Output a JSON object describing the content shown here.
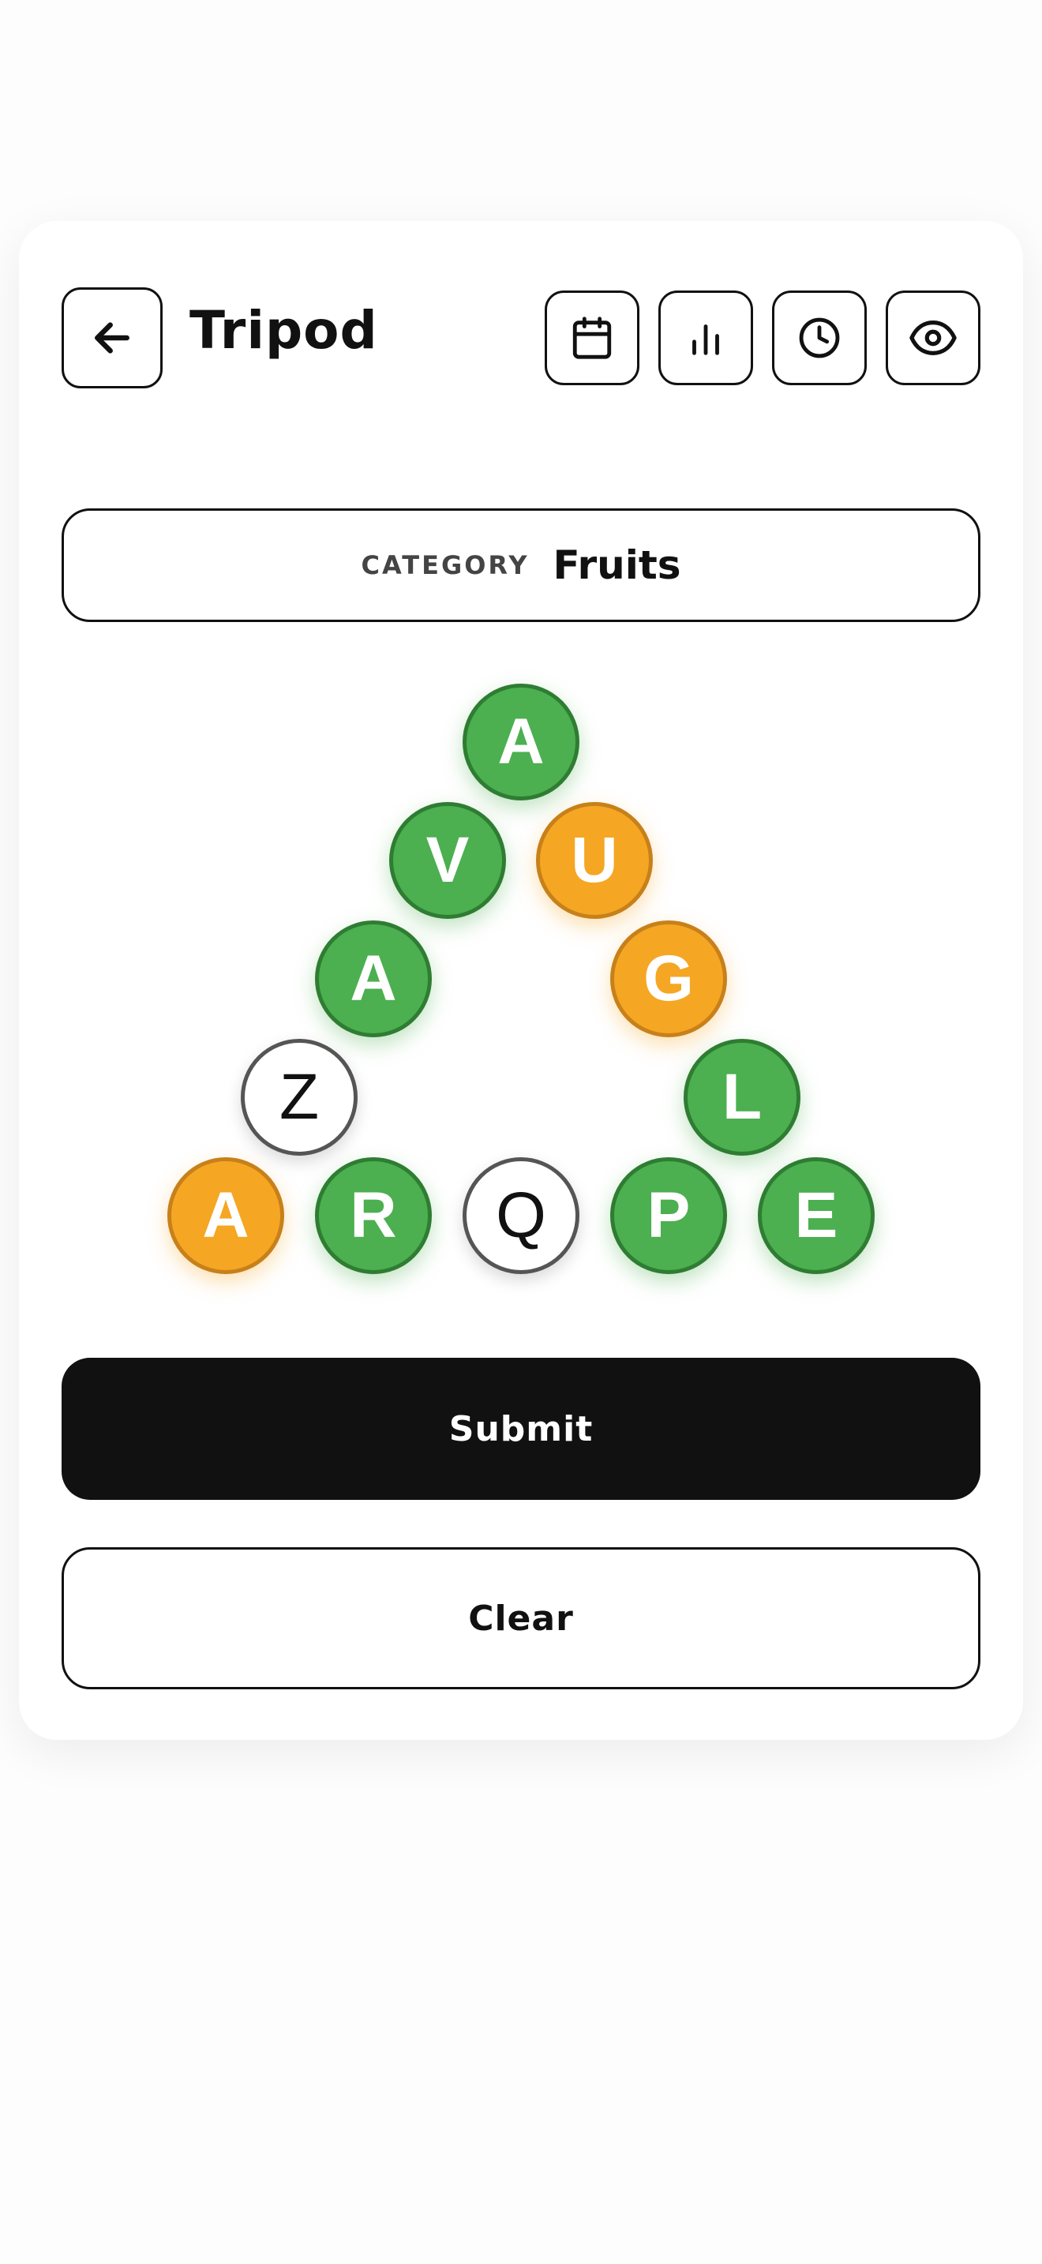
{
  "header": {
    "title": "Tripod",
    "icons": [
      "back-arrow-icon",
      "calendar-icon",
      "stats-icon",
      "clock-icon",
      "eye-icon"
    ]
  },
  "category": {
    "label": "CATEGORY",
    "value": "Fruits"
  },
  "board": {
    "tiles": [
      {
        "letter": "A",
        "state": "green"
      },
      {
        "letter": "V",
        "state": "green"
      },
      {
        "letter": "U",
        "state": "orange"
      },
      {
        "letter": "A",
        "state": "green"
      },
      {
        "letter": "G",
        "state": "orange"
      },
      {
        "letter": "Z",
        "state": "blank"
      },
      {
        "letter": "L",
        "state": "green"
      },
      {
        "letter": "A",
        "state": "orange"
      },
      {
        "letter": "R",
        "state": "green"
      },
      {
        "letter": "Q",
        "state": "blank"
      },
      {
        "letter": "P",
        "state": "green"
      },
      {
        "letter": "E",
        "state": "green"
      }
    ]
  },
  "actions": {
    "submit_label": "Submit",
    "clear_label": "Clear"
  },
  "colors": {
    "green": "#4caf50",
    "orange": "#f5a623",
    "dark": "#111111"
  }
}
